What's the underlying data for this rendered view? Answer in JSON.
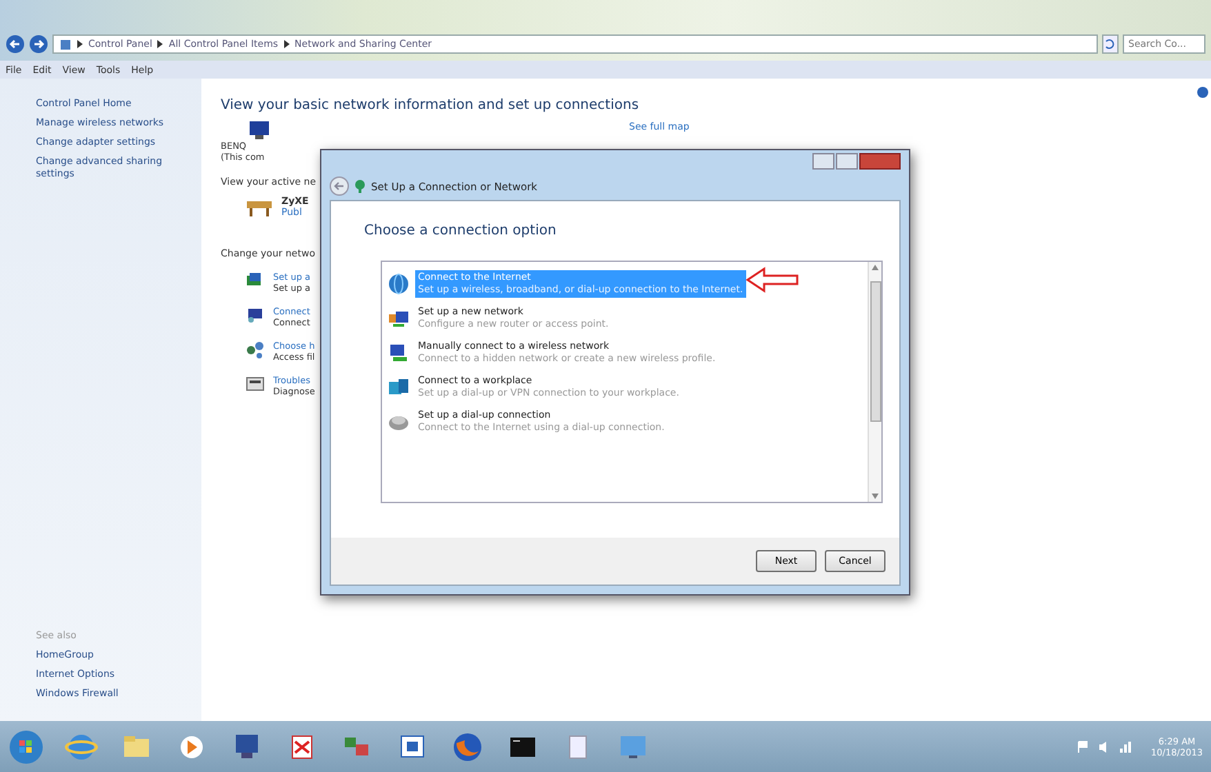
{
  "address_bar": {
    "crumbs": [
      "Control Panel",
      "All Control Panel Items",
      "Network and Sharing Center"
    ],
    "search_placeholder": "Search Co..."
  },
  "menu": [
    "File",
    "Edit",
    "View",
    "Tools",
    "Help"
  ],
  "sidebar": {
    "items": [
      "Control Panel Home",
      "Manage wireless networks",
      "Change adapter settings",
      "Change advanced sharing settings"
    ],
    "see_also_heading": "See also",
    "see_also": [
      "HomeGroup",
      "Internet Options",
      "Windows Firewall"
    ]
  },
  "main": {
    "heading": "View your basic network information and set up connections",
    "computer": {
      "name": "BENQ",
      "note": "(This com"
    },
    "see_full_map": "See full map",
    "active_heading": "View your active ne",
    "network": {
      "name": "ZyXE",
      "type": "Publ"
    },
    "change_heading": "Change your netwo",
    "tasks": [
      {
        "title": "Set up a",
        "desc": "Set up a"
      },
      {
        "title": "Connect",
        "desc": "Connect"
      },
      {
        "title": "Choose h",
        "desc": "Access fil"
      },
      {
        "title": "Troubles",
        "desc": "Diagnose"
      }
    ]
  },
  "dialog": {
    "title": "Set Up a Connection or Network",
    "heading": "Choose a connection option",
    "options": [
      {
        "title": "Connect to the Internet",
        "desc": "Set up a wireless, broadband, or dial-up connection to the Internet.",
        "selected": true
      },
      {
        "title": "Set up a new network",
        "desc": "Configure a new router or access point.",
        "selected": false
      },
      {
        "title": "Manually connect to a wireless network",
        "desc": "Connect to a hidden network or create a new wireless profile.",
        "selected": false
      },
      {
        "title": "Connect to a workplace",
        "desc": "Set up a dial-up or VPN connection to your workplace.",
        "selected": false
      },
      {
        "title": "Set up a dial-up connection",
        "desc": "Connect to the Internet using a dial-up connection.",
        "selected": false
      }
    ],
    "buttons": [
      "Next",
      "Cancel"
    ]
  },
  "taskbar": {
    "time": "6:29 AM",
    "date": "10/18/2013"
  }
}
